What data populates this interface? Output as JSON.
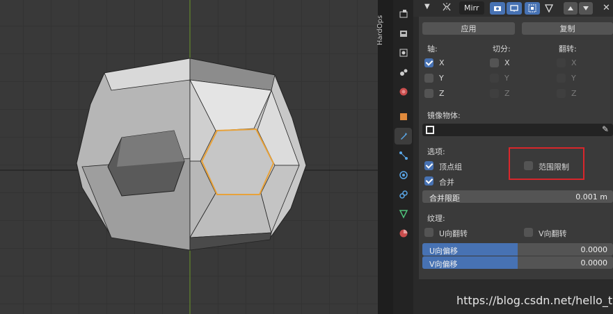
{
  "sidebar_tab_label": "HardOps",
  "modifier": {
    "name": "Mirr",
    "apply_label": "应用",
    "copy_label": "复制"
  },
  "axis_section": {
    "axis_label": "轴:",
    "bisect_label": "切分:",
    "flip_label": "翻转:",
    "axis": [
      {
        "label": "X",
        "checked": true
      },
      {
        "label": "Y",
        "checked": false
      },
      {
        "label": "Z",
        "checked": false
      }
    ],
    "bisect": [
      {
        "label": "X"
      },
      {
        "label": "Y"
      },
      {
        "label": "Z"
      }
    ],
    "flip": [
      {
        "label": "X"
      },
      {
        "label": "Y"
      },
      {
        "label": "Z"
      }
    ]
  },
  "mirror_object_label": "镜像物体:",
  "options": {
    "title": "选项:",
    "vertex_groups": "顶点组",
    "clipping": "范围限制",
    "merge": "合并",
    "merge_distance_label": "合并限距",
    "merge_distance_value": "0.001 m"
  },
  "textures": {
    "title": "纹理:",
    "flip_u": "U向翻转",
    "flip_v": "V向翻转",
    "u_offset_label": "U向偏移",
    "u_offset_value": "0.0000",
    "v_offset_label": "V向偏移",
    "v_offset_value": "0.0000"
  },
  "watermark": "https://blog.csdn.net/hello_tute",
  "colors": {
    "accent": "#4772b3",
    "highlight_box": "#d9262b",
    "selection": "#e8a23a"
  }
}
